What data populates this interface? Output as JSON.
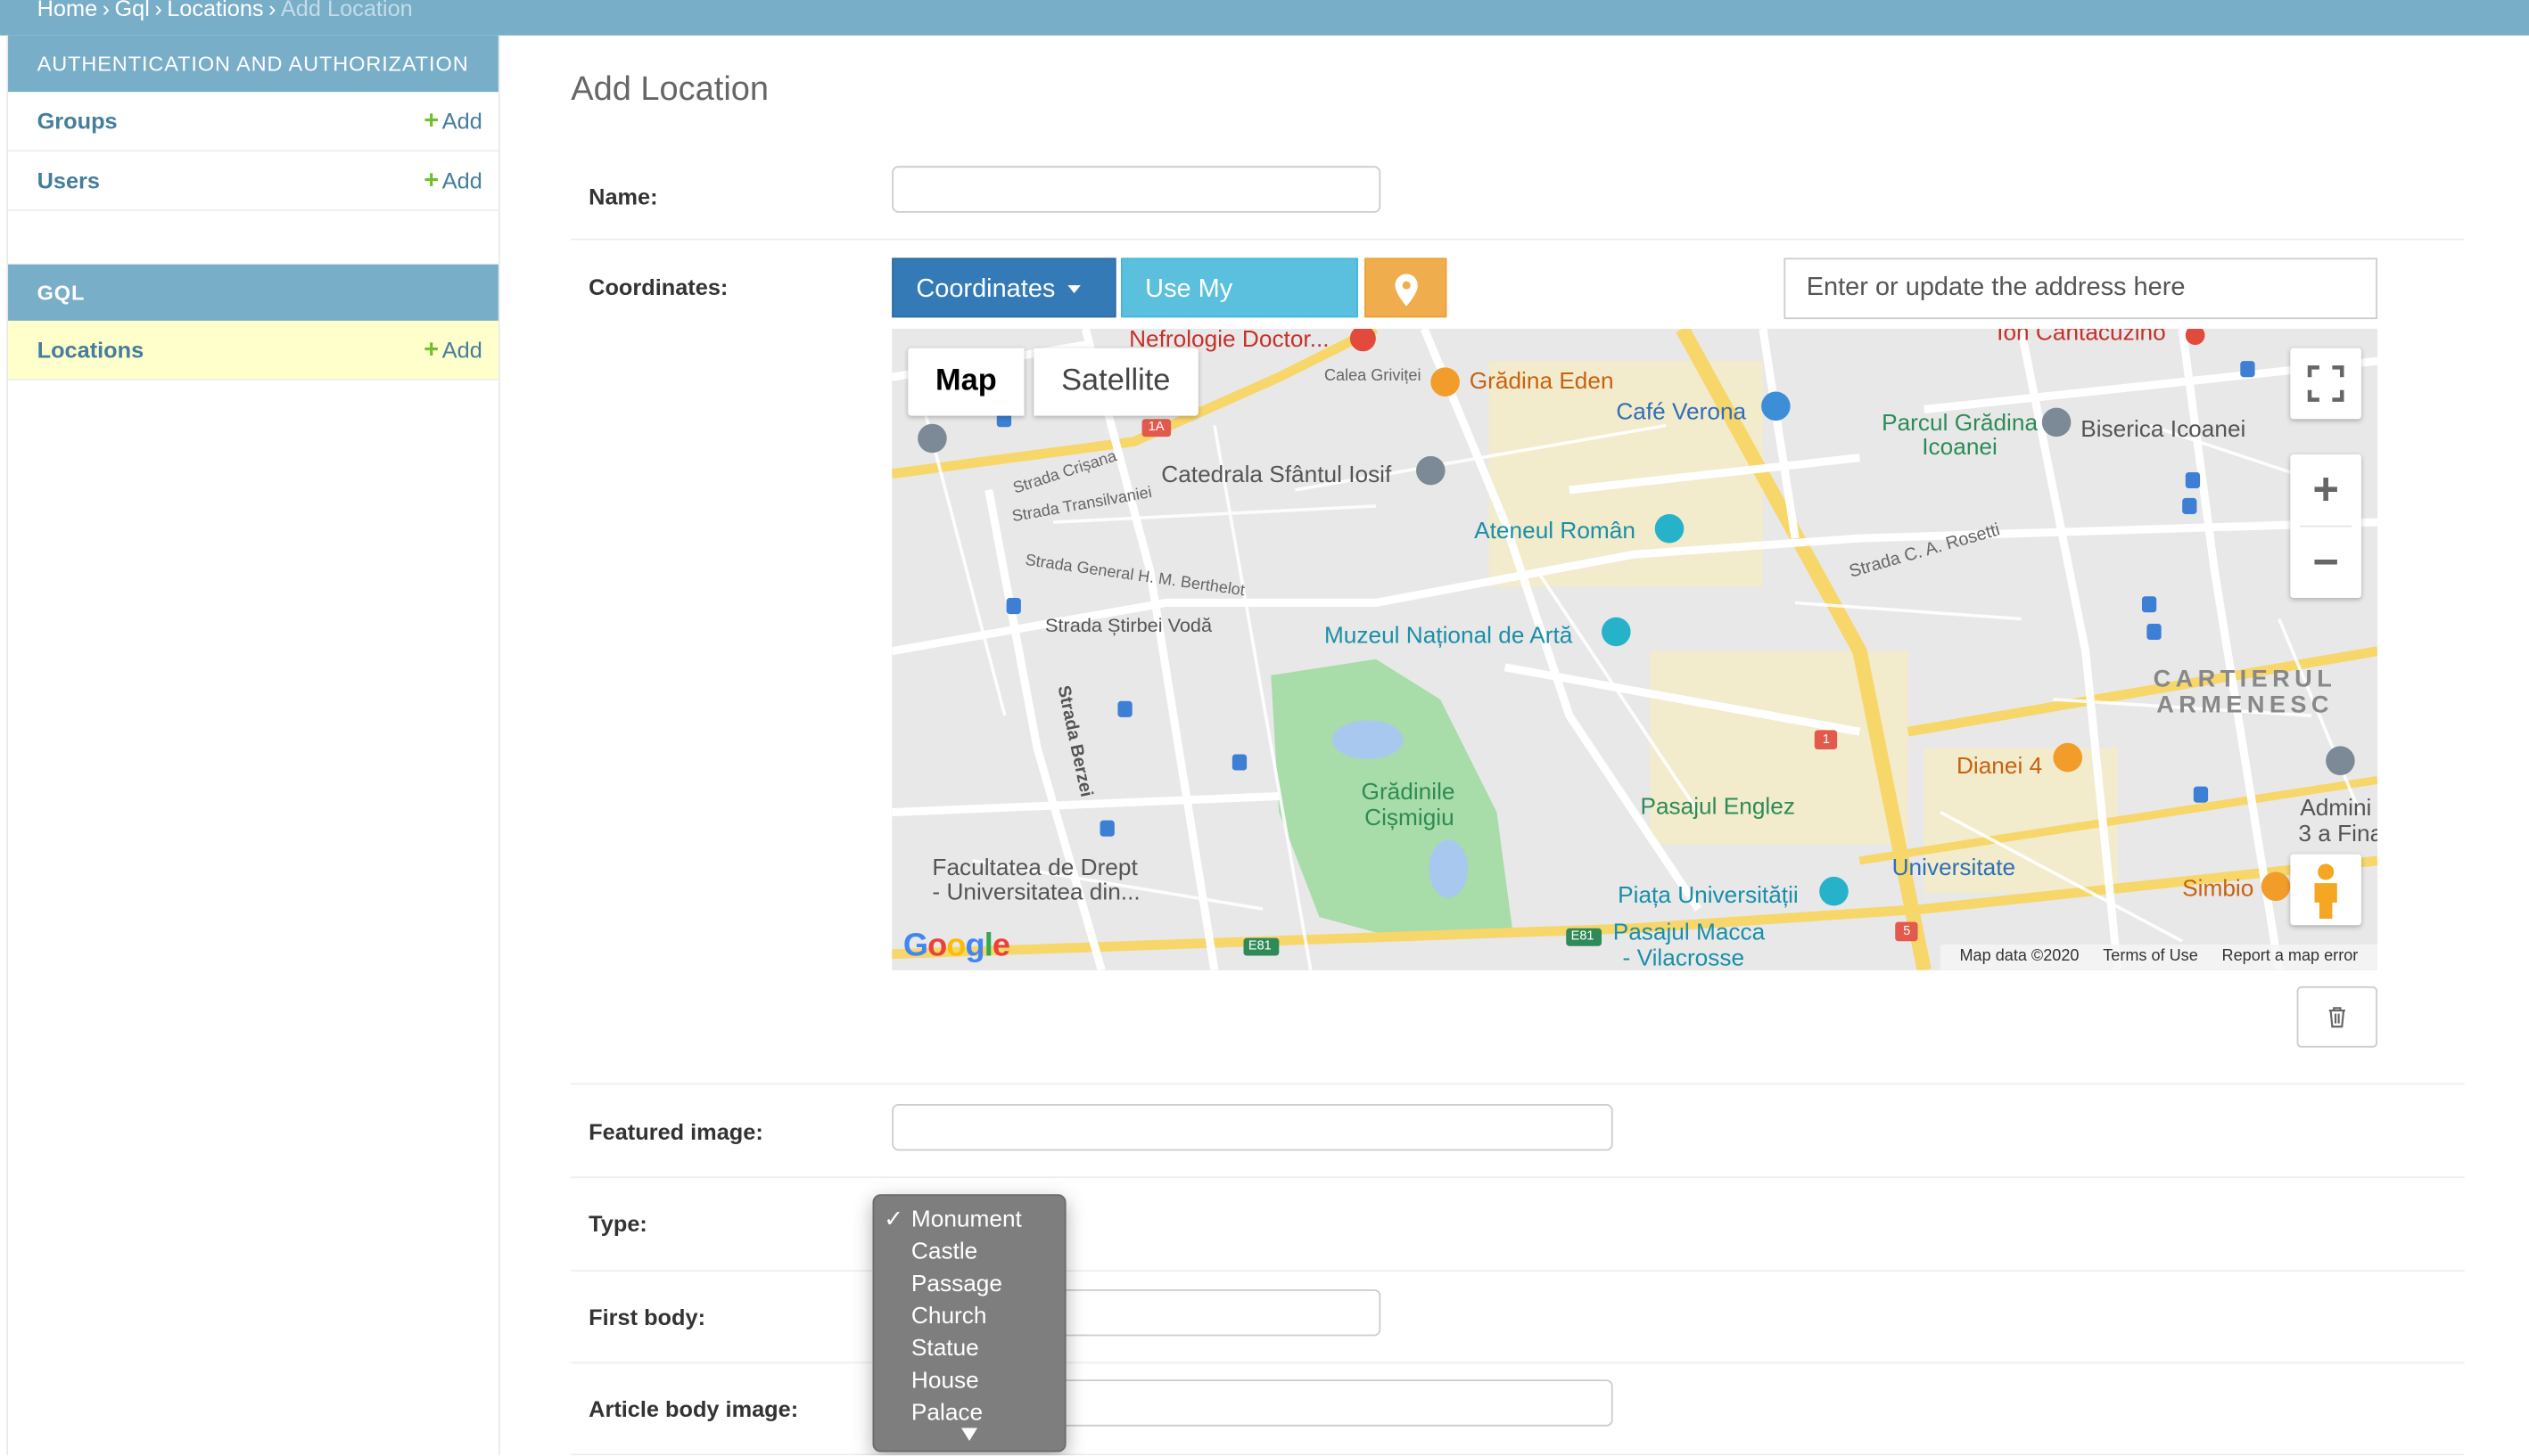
{
  "breadcrumbs": {
    "items": [
      "Home",
      "Gql",
      "Locations"
    ],
    "current": "Add Location",
    "separator": "›"
  },
  "sidebar": {
    "auth_caption": "AUTHENTICATION AND AUTHORIZATION",
    "auth_items": [
      {
        "label": "Groups",
        "add": "Add"
      },
      {
        "label": "Users",
        "add": "Add"
      }
    ],
    "gql_caption": "GQL",
    "gql_items": [
      {
        "label": "Locations",
        "add": "Add"
      }
    ]
  },
  "page": {
    "title": "Add Location"
  },
  "form": {
    "name_label": "Name:",
    "name_value": "",
    "coordinates_label": "Coordinates:",
    "coordinates_button": "Coordinates",
    "use_my_location_button": "Use My Location",
    "address_placeholder": "Enter or update the address here",
    "featured_image_label": "Featured image:",
    "type_label": "Type:",
    "first_body_label": "First body:",
    "article_body_image_label": "Article body image:"
  },
  "map": {
    "map_type_map": "Map",
    "map_type_satellite": "Satellite",
    "zoom_in": "+",
    "zoom_out": "−",
    "google_logo": "Google",
    "footer": {
      "map_data": "Map data ©2020",
      "terms": "Terms of Use",
      "report": "Report a map error"
    },
    "labels": {
      "nefrologie": "Nefrologie Doctor...",
      "calea_grivitei": "Calea Griviței",
      "gradina_eden": "Grădina Eden",
      "cafe_verona": "Café Verona",
      "ion_cantacuzino": "Ion Cantacuzino",
      "parcul_gradina_icoanei": "Parcul Grădina Icoanei",
      "biserica_icoanei": "Biserica Icoanei",
      "catedrala": "Catedrala Sfântul Iosif",
      "strada_crisana": "Strada Crișana",
      "strada_transilvaniei": "Strada Transilvaniei",
      "ateneul": "Ateneul Român",
      "strada_general": "Strada General H. M. Berthelot",
      "strada_ca_rosetti": "Strada C. A. Rosetti",
      "strada_stirbei": "Strada Știrbei Vodă",
      "muzeul": "Muzeul Național de Artă",
      "cartierul": "CARTIERUL",
      "armenesc": "ARMENESC",
      "gradinile": "Grădinile",
      "cismigiu": "Cișmigiu",
      "dianei": "Dianei 4",
      "pasajul_englez": "Pasajul Englez",
      "facultatea": "Facultatea de Drept",
      "universitatea_din": "- Universitatea din...",
      "universitate": "Universitate",
      "piata": "Piața Universității",
      "pasajul_macca": "Pasajul Macca",
      "vilacrosse": "- Vilacrosse",
      "simbio": "Simbio",
      "admini": "Admini",
      "fina": "3 a Fina",
      "strada_berzei": "Strada Berzei",
      "e81": "E81",
      "r1a": "1A",
      "r1": "1",
      "r5": "5"
    }
  },
  "type_dropdown": {
    "options": [
      "Monument",
      "Castle",
      "Passage",
      "Church",
      "Statue",
      "House",
      "Palace"
    ],
    "selected": "Monument",
    "check": "✓"
  },
  "colors": {
    "header": "#79aec8",
    "link": "#447e9b",
    "add_green": "#70bf2b",
    "current_row": "#ffffcc",
    "btn_primary": "#337ab7",
    "btn_info": "#5bc0de",
    "btn_warning": "#f0ad4e"
  }
}
